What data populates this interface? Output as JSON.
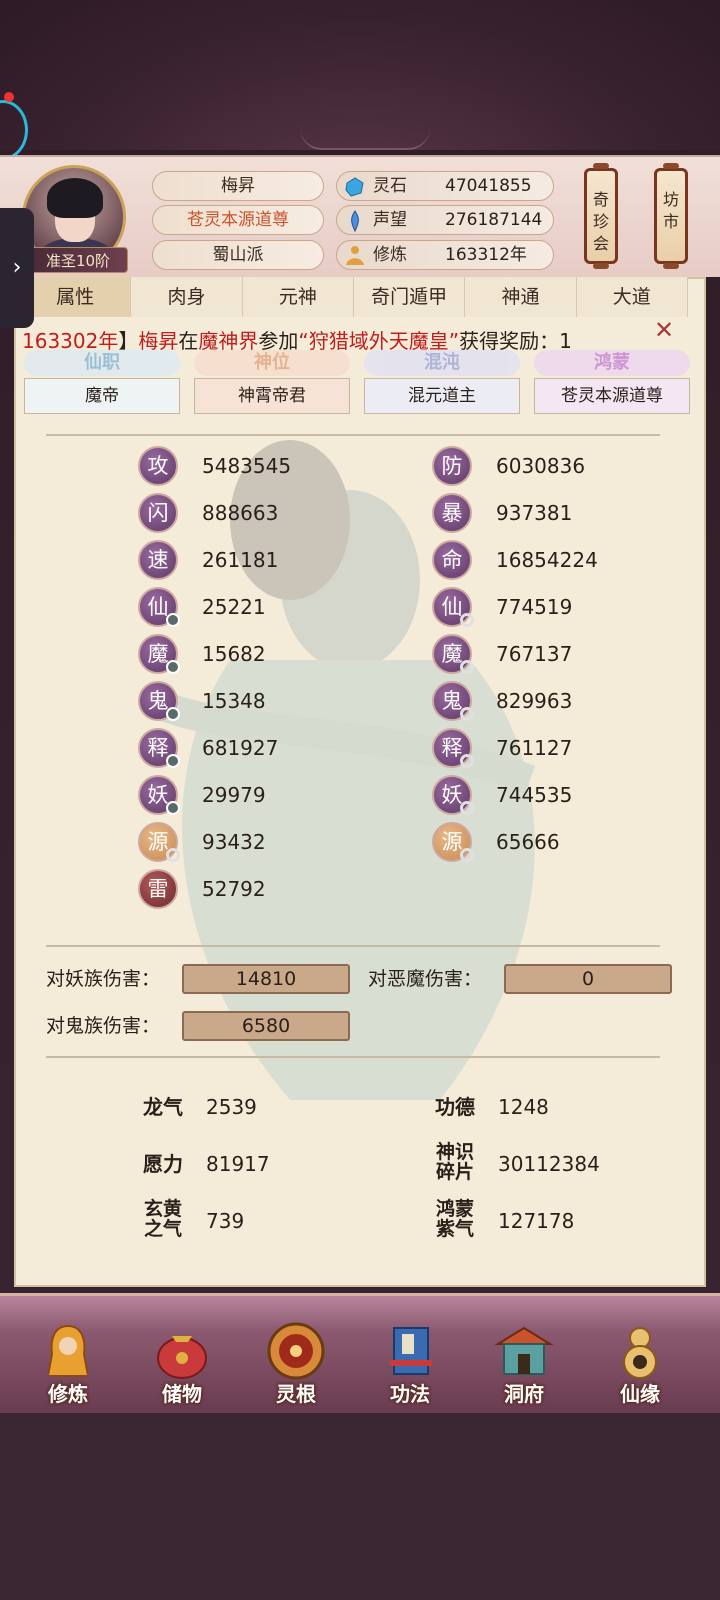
{
  "header": {
    "rank_badge": "准圣10阶",
    "name": "梅昇",
    "title": "苍灵本源道尊",
    "sect": "蜀山派",
    "resources": [
      {
        "icon": "spirit-stone-icon",
        "label": "灵石",
        "value": "47041855"
      },
      {
        "icon": "reputation-icon",
        "label": "声望",
        "value": "276187144"
      },
      {
        "icon": "cultivation-icon",
        "label": "修炼",
        "value": "163312年"
      }
    ],
    "buttons": {
      "treasure": "奇珍会",
      "market": "坊市"
    }
  },
  "tabs": [
    "属性",
    "肉身",
    "元神",
    "奇门遁甲",
    "神通",
    "大道"
  ],
  "ticker": {
    "year": "163302年",
    "bracket": "】",
    "player": "梅昇",
    "mid1": "在",
    "realm": "魔神界",
    "mid2": "参加",
    "event": "“狩猎域外天魔皇”",
    "tail": "获得奖励：1"
  },
  "ranks": [
    {
      "ribbon": "仙职",
      "value": "魔帝",
      "color": "#7fb0d6"
    },
    {
      "ribbon": "神位",
      "value": "神霄帝君",
      "color": "#e2a07a"
    },
    {
      "ribbon": "混沌",
      "value": "混元道主",
      "color": "#9aa0d8"
    },
    {
      "ribbon": "鸿蒙",
      "value": "苍灵本源道尊",
      "color": "#c27ad0"
    }
  ],
  "stats_left": [
    {
      "glyph": "攻",
      "value": "5483545"
    },
    {
      "glyph": "闪",
      "value": "888663"
    },
    {
      "glyph": "速",
      "value": "261181"
    },
    {
      "glyph": "仙",
      "value": "25221"
    },
    {
      "glyph": "魔",
      "value": "15682"
    },
    {
      "glyph": "鬼",
      "value": "15348"
    },
    {
      "glyph": "释",
      "value": "681927"
    },
    {
      "glyph": "妖",
      "value": "29979"
    },
    {
      "glyph": "源",
      "value": "93432"
    },
    {
      "glyph": "雷",
      "value": "52792"
    }
  ],
  "stats_right": [
    {
      "glyph": "防",
      "value": "6030836"
    },
    {
      "glyph": "暴",
      "value": "937381"
    },
    {
      "glyph": "命",
      "value": "16854224"
    },
    {
      "glyph": "仙",
      "value": "774519"
    },
    {
      "glyph": "魔",
      "value": "767137"
    },
    {
      "glyph": "鬼",
      "value": "829963"
    },
    {
      "glyph": "释",
      "value": "761127"
    },
    {
      "glyph": "妖",
      "value": "744535"
    },
    {
      "glyph": "源",
      "value": "65666"
    }
  ],
  "damage": {
    "yao_label": "对妖族伤害：",
    "yao_value": "14810",
    "demon_label": "对恶魔伤害：",
    "demon_value": "0",
    "ghost_label": "对鬼族伤害：",
    "ghost_value": "6580"
  },
  "misc": {
    "dragon": {
      "label": "龙气",
      "value": "2539"
    },
    "merit": {
      "label": "功德",
      "value": "1248"
    },
    "wish": {
      "label": "愿力",
      "value": "81917"
    },
    "shard": {
      "label1": "神识",
      "label2": "碎片",
      "value": "30112384"
    },
    "xuanhuang": {
      "label1": "玄黄",
      "label2": "之气",
      "value": "739"
    },
    "hongmeng": {
      "label1": "鸿蒙",
      "label2": "紫气",
      "value": "127178"
    }
  },
  "nav": [
    "修炼",
    "储物",
    "灵根",
    "功法",
    "洞府",
    "仙缘"
  ]
}
